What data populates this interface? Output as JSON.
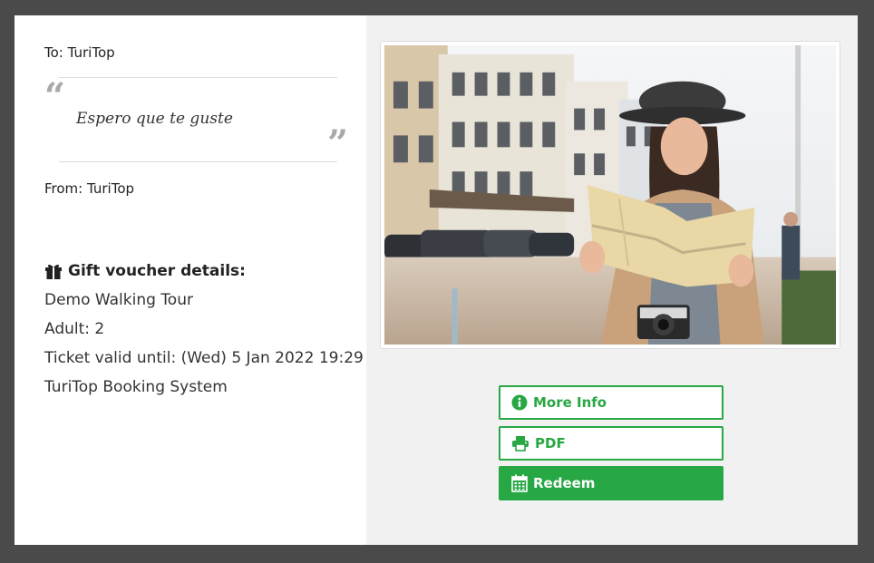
{
  "voucher": {
    "to_label": "To: TuriTop",
    "message": "Espero que te guste",
    "from_label": "From: TuriTop",
    "details_title": "Gift voucher details:",
    "details_lines": [
      "Demo Walking Tour",
      "Adult: 2",
      "Ticket valid until: (Wed) 5 Jan 2022 19:29",
      "TuriTop Booking System"
    ]
  },
  "actions": {
    "more_info_label": "More Info",
    "pdf_label": "PDF",
    "redeem_label": "Redeem"
  },
  "icons": {
    "details": "gift-icon",
    "more_info": "info-circle-icon",
    "pdf": "printer-icon",
    "redeem": "calendar-icon"
  },
  "colors": {
    "accent": "#28a745",
    "background": "#4a4a4a",
    "right_panel": "#f1f1f1"
  }
}
